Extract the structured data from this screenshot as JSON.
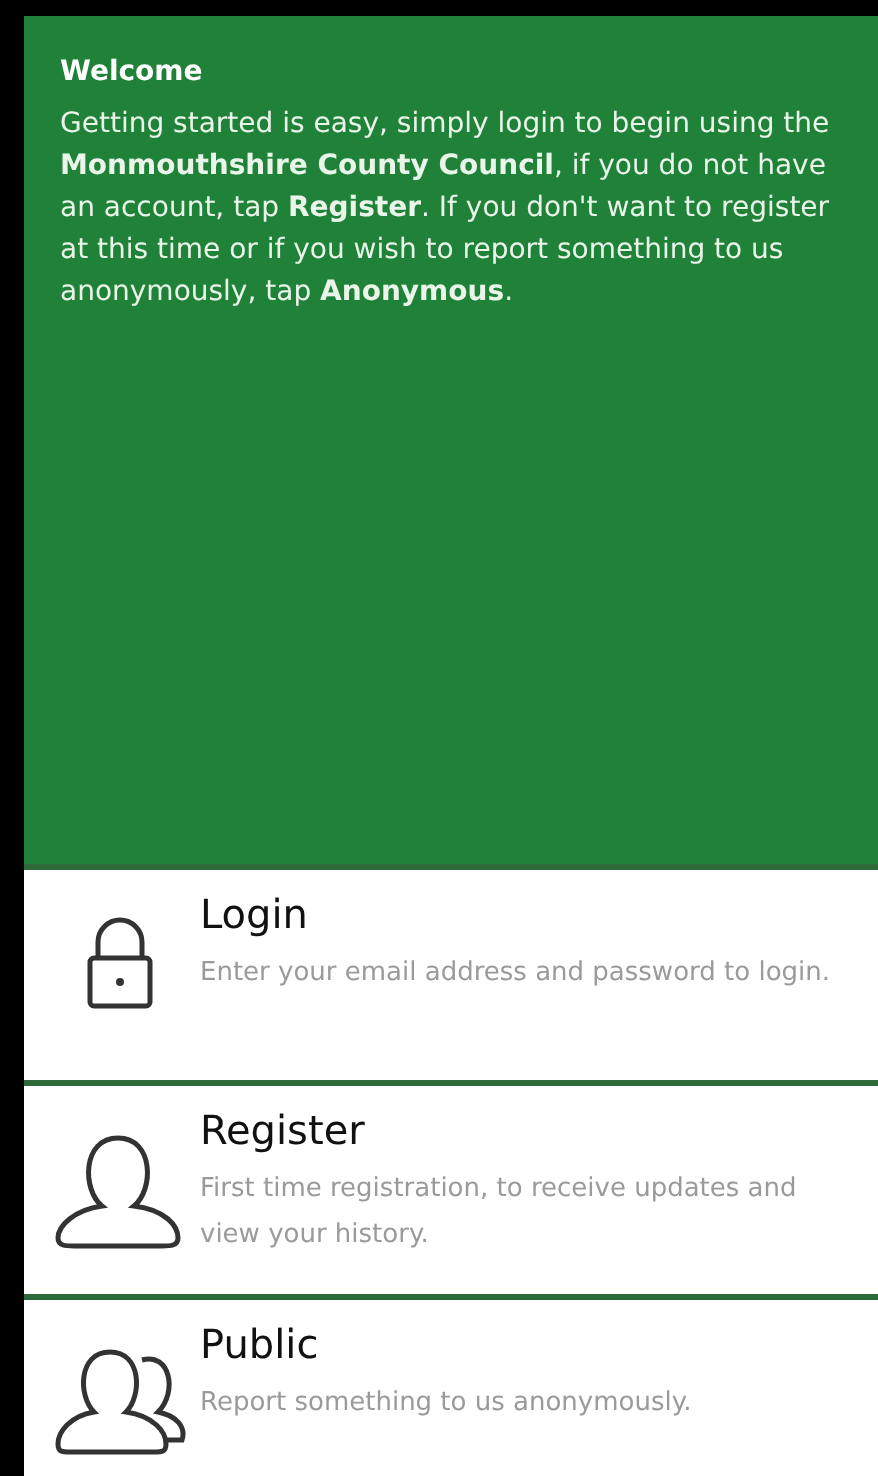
{
  "welcome": {
    "title": "Welcome",
    "text": "Getting started is easy, simply login to begin using the **Monmouthshire County Council**, if you do not have an account, tap **Register**. If you don't want to register at this time or if you wish to report something to us anonymously, tap **Anonymous**."
  },
  "options": [
    {
      "kind": "lock",
      "title": "Login",
      "description": "Enter your email address and password to login."
    },
    {
      "kind": "person",
      "title": "Register",
      "description": "First time registration, to receive updates and view your history."
    },
    {
      "kind": "people",
      "title": "Public",
      "description": "Report something to us anonymously."
    }
  ]
}
